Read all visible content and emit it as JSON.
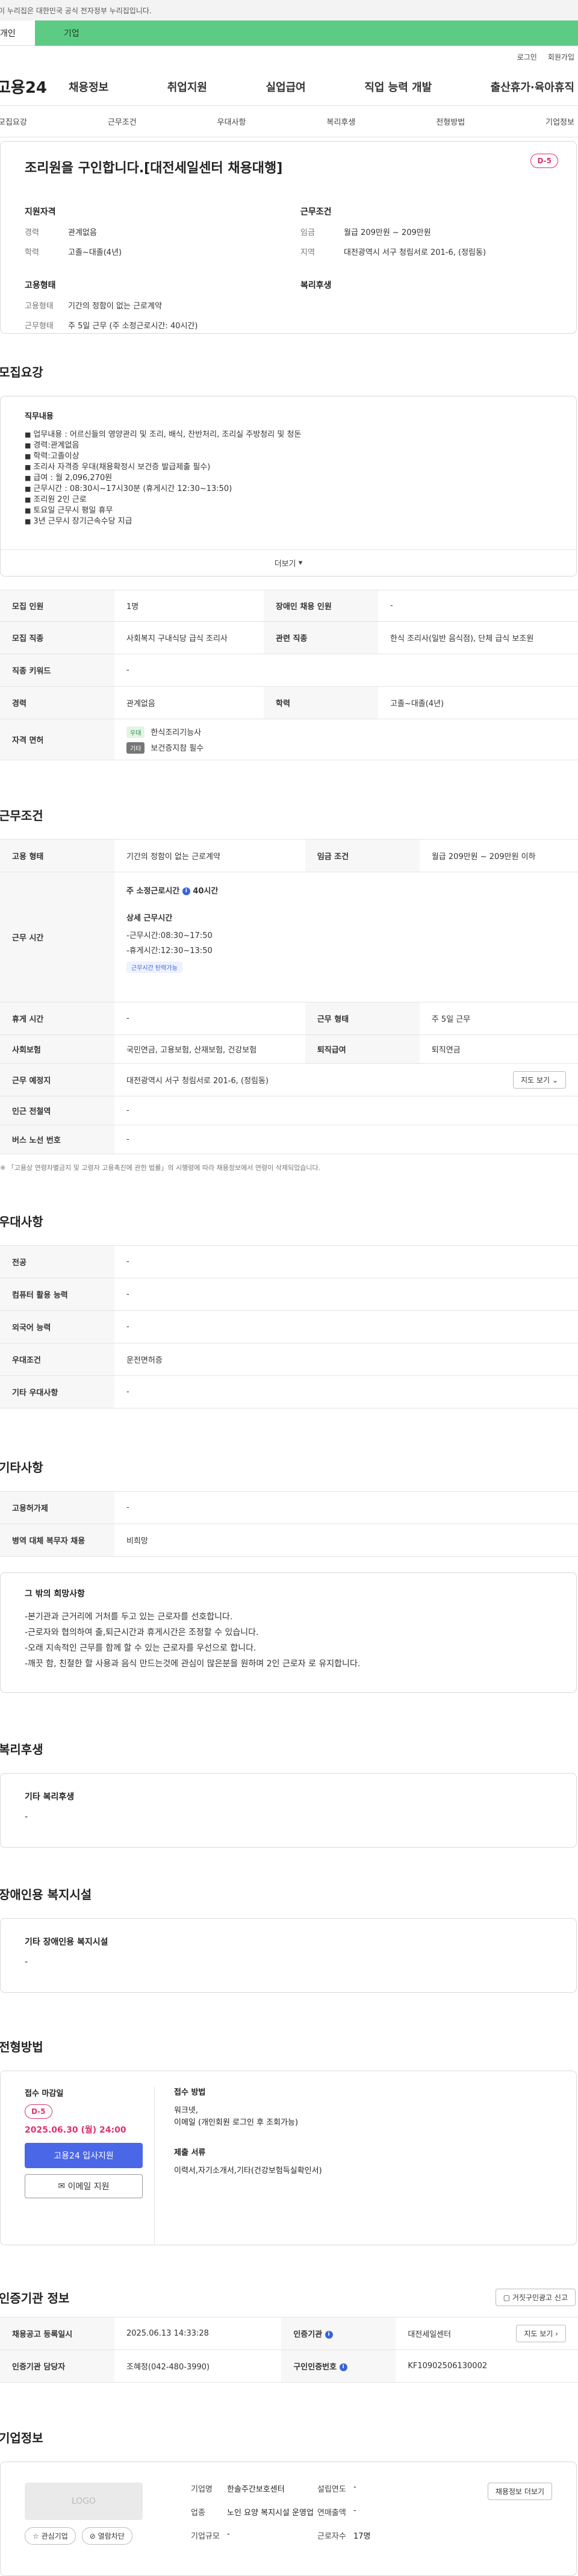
{
  "gov_banner": "이 누리집은 대한민국 공식 전자정부 누리집입니다.",
  "site_tabs": {
    "personal": "개인",
    "enterprise": "기업"
  },
  "utility": {
    "login": "로그인",
    "signup": "회원가입"
  },
  "logo": "고용24",
  "gnb": [
    "채용정보",
    "취업지원",
    "실업급여",
    "직업 능력 개발",
    "출산휴가·육아휴직"
  ],
  "subnav": [
    "모집요강",
    "근무조건",
    "우대사항",
    "복리후생",
    "전형방법",
    "기업정보"
  ],
  "header": {
    "title": "조리원을 구인합니다.[대전세일센터 채용대행]",
    "dday": "D-5",
    "qual_title": "지원자격",
    "qual": [
      {
        "k": "경력",
        "v": "관계없음"
      },
      {
        "k": "학력",
        "v": "고졸~대졸(4년)"
      }
    ],
    "emp_title": "고용형태",
    "emp": [
      {
        "k": "고용형태",
        "v": "기간의 정함이 없는 근로계약"
      },
      {
        "k": "근무형태",
        "v": "주 5일 근무 (주 소정근로시간: 40시간)"
      }
    ],
    "cond_title": "근무조건",
    "cond": [
      {
        "k": "임금",
        "v": "월급 209만원 ~ 209만원"
      },
      {
        "k": "지역",
        "v": "대전광역시 서구 청림서로 201-6, (정림동)"
      }
    ],
    "welfare_title": "복리후생"
  },
  "recruit": {
    "section": "모집요강",
    "duty_title": "직무내용",
    "duties": [
      "업무내용 : 어르신들의 영양관리 및 조리, 배식, 잔반처리, 조리실 주방청리 및 청돈",
      "경력:관계없음",
      "학력:고졸이상",
      "조리사 자격증 우대(채용확정시 보건증 발급제출 필수)",
      "급여 : 월 2,096,270원",
      "근무시간 : 08:30시~17시30분 (휴게시간 12:30~13:50)",
      "조리원 2인 근로",
      "토요일 근무시 평일 휴무",
      "3년 근무시 장기근속수당 지급"
    ],
    "more": "더보기",
    "rows": [
      {
        "k1": "모집 인원",
        "v1": "1명",
        "k2": "장애인 채용 인원",
        "v2": "-"
      },
      {
        "k1": "모집 직종",
        "v1": "사회복지 구내식당 급식 조리사",
        "k2": "관련 직종",
        "v2": "한식 조리사(일반 음식점), 단체 급식 보조원"
      },
      {
        "k1": "직종 키워드",
        "v1": "-"
      },
      {
        "k1": "경력",
        "v1": "관계없음",
        "k2": "학력",
        "v2": "고졸~대졸(4년)"
      }
    ],
    "license_key": "자격 면허",
    "licenses": [
      {
        "chip": "우대",
        "name": "한식조리기능사"
      },
      {
        "chip": "기타",
        "name": "보건증지참 필수"
      }
    ]
  },
  "work": {
    "section": "근무조건",
    "emp_type_k": "고용 형태",
    "emp_type_v": "기간의 정함이 없는 근로계약",
    "wage_k": "임금 조건",
    "wage_v": "월급 209만원 ~ 209만원 이하",
    "hours_k": "근무 시간",
    "hours_weekly_label": "주 소정근로시간",
    "hours_weekly_value": "40시간",
    "hours_detail_title": "상세 근무시간",
    "hours_lines": [
      "-근무시간:08:30~17:50",
      "-휴게시간:12:30~13:50"
    ],
    "hours_badge": "근무시간 탄력가능",
    "rows": [
      {
        "k1": "휴게 시간",
        "v1": "-",
        "k2": "근무 형태",
        "v2": "주 5일 근무"
      },
      {
        "k1": "사회보험",
        "v1": "국민연금, 고용보험, 산재보험, 건강보험",
        "k2": "퇴직급여",
        "v2": "퇴직연금"
      }
    ],
    "place_k": "근무 예정지",
    "place_v": "대전광역시 서구 청림서로 201-6, (정림동)",
    "map_btn": "지도 보기",
    "station_k": "인근 전철역",
    "station_v": "-",
    "bus_k": "버스 노선 번호",
    "bus_v": "-",
    "footnote": "※ 「고용상 연령차별금지 및 고령자 고용촉진에 관한 법률」의 시행령에 따라 채용정보에서 연령이 삭제되었습니다."
  },
  "pref": {
    "section": "우대사항",
    "rows": [
      {
        "k": "전공",
        "v": "-"
      },
      {
        "k": "컴퓨터 활용 능력",
        "v": "-"
      },
      {
        "k": "외국어 능력",
        "v": "-"
      },
      {
        "k": "우대조건",
        "v": "운전면허증"
      },
      {
        "k": "기타 우대사항",
        "v": "-"
      }
    ]
  },
  "other": {
    "section": "기타사항",
    "rows": [
      {
        "k": "고용허가제",
        "v": "-"
      },
      {
        "k": "병역 대체 복무자 채용",
        "v": "비희망"
      }
    ],
    "note_title": "그 밖의 희망사항",
    "notes": [
      "-본기관과 근거리에 거처를 두고 있는 근로자를 선호합니다.",
      "-근로자와 협의하여 출,퇴근시간과 휴게시간은 조정할 수 있습니다.",
      "-오래 지속적인 근무를 함께 할 수 있는 근로자를 우선으로 합니다.",
      "-깨끗 함, 친절한 할 사용과 음식 만드는것에 관심이 많은분을 원하며 2인 근로자 로 유지합니다."
    ]
  },
  "welfare": {
    "section": "복리후생",
    "title": "기타 복리후생",
    "value": "-"
  },
  "disabled": {
    "section": "장애인용 복지시설",
    "title": "기타 장애인용 복지시설",
    "value": "-"
  },
  "process": {
    "section": "전형방법",
    "deadline_title": "접수 마감일",
    "deadline": "2025.06.30 (월) 24:00",
    "dday": "D-5",
    "apply_btn": "고용24 입사지원",
    "email_btn": "이메일 지원",
    "method_title": "접수 방법",
    "methods": [
      "워크넷,",
      "이메일 (개인회원 로그인 후 조회가능)"
    ],
    "docs_title": "제출 서류",
    "docs": "이력서,자기소개서,기타(건강보험득실확인서)"
  },
  "agency": {
    "section": "인증기관 정보",
    "report_btn": "거짓구인광고 신고",
    "r1": {
      "k1": "채용공고 등록일시",
      "v1": "2025.06.13 14:33:28",
      "k2": "인증기관",
      "v2": "대전세일센터",
      "btn": "지도 보기"
    },
    "r2": {
      "k1": "인증기관 담당자",
      "v1": "조혜정(042-480-3990)",
      "k2": "구인인증번호",
      "v2": "KF10902506130002"
    }
  },
  "company": {
    "section": "기업정보",
    "logo": "LOGO",
    "fav_btn": "관심기업",
    "follow_btn": "열람차단",
    "info_btn": "채용정보 더보기",
    "fields": [
      {
        "k": "기업명",
        "v": "한솔주간보호센터",
        "k2": "설립연도",
        "v2": "-"
      },
      {
        "k": "업종",
        "v": "노인 요양 복지시설 운영업",
        "k2": "연매출액",
        "v2": "-"
      },
      {
        "k": "기업규모",
        "v": "-",
        "k2": "근로자수",
        "v2": "17명"
      }
    ]
  }
}
